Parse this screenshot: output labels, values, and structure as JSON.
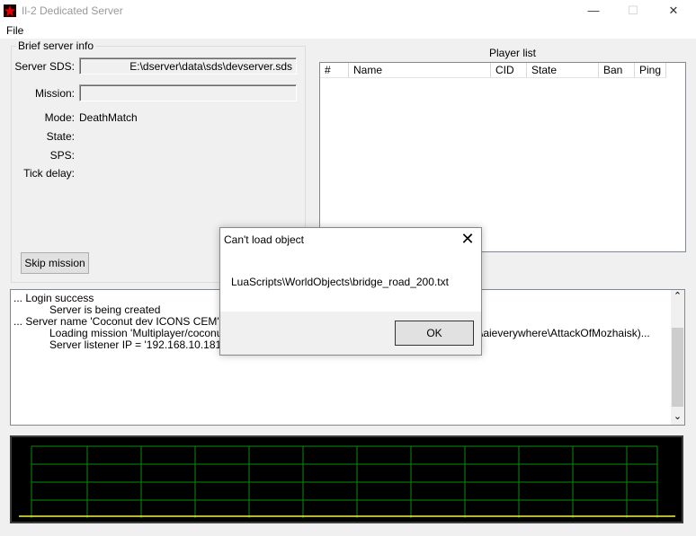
{
  "window": {
    "title": "Il-2 Dedicated Server",
    "minimize": "—",
    "maximize": "☐",
    "close": "✕"
  },
  "menu": {
    "file": "File"
  },
  "server_info": {
    "group_title": "Brief server info",
    "server_sds_label": "Server SDS:",
    "server_sds_value": "E:\\dserver\\data\\sds\\devserver.sds",
    "mission_label": "Mission:",
    "mission_value": "",
    "mode_label": "Mode:",
    "mode_value": "DeathMatch",
    "state_label": "State:",
    "sps_label": "SPS:",
    "tick_delay_label": "Tick delay:",
    "skip_button": "Skip mission"
  },
  "player_list": {
    "title": "Player list",
    "columns": [
      "#",
      "Name",
      "CID",
      "State",
      "Ban",
      "Ping"
    ]
  },
  "log": {
    "lines": [
      "... Login success",
      "            Server is being created",
      "... Server name 'Coconut dev ICONS CEM'",
      "            Loading mission 'Multiplayer/coconut\\a",
      "            Server listener IP = '192.168.10.181'"
    ],
    "line_tail": "\\aieverywhere\\AttackOfMozhaisk)...",
    "scroll_up": "⌃",
    "scroll_down": "⌄"
  },
  "dialog": {
    "title": "Can't load object",
    "message": "LuaScripts\\WorldObjects\\bridge_road_200.txt",
    "ok_button": "OK",
    "close": "✕"
  },
  "colors": {
    "graph_grid": "#0a8a0a",
    "graph_line": "#f5f53c",
    "graph_bg": "#000000"
  }
}
